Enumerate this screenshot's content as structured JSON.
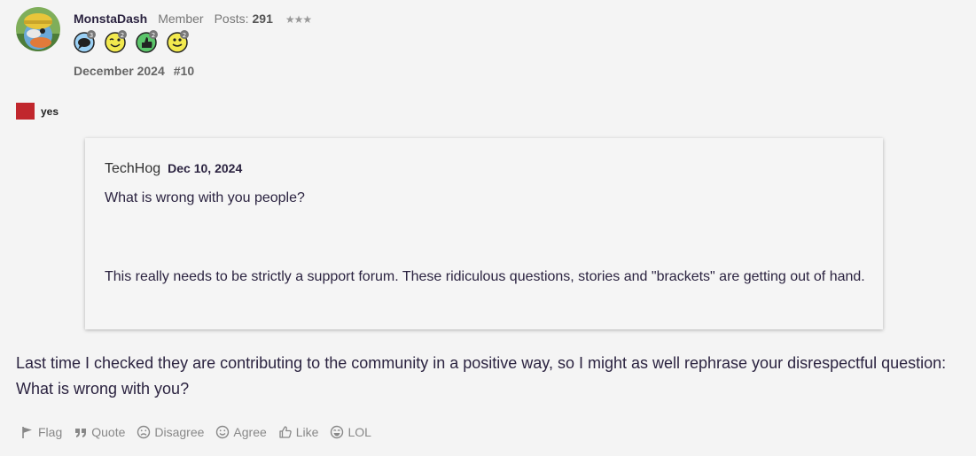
{
  "post": {
    "author": "MonstaDash",
    "role": "Member",
    "posts_label": "Posts:",
    "posts_count": "291",
    "stars": "★★★",
    "date": "December 2024",
    "number": "#10",
    "badges": [
      {
        "icon": "speech-bubble-icon",
        "count": "3",
        "color": "#9ad0f5"
      },
      {
        "icon": "wink-face-icon",
        "count": "2",
        "color": "#f2e94e"
      },
      {
        "icon": "thumbs-up-icon",
        "count": "2",
        "color": "#5bc56a"
      },
      {
        "icon": "smile-face-icon",
        "count": "2",
        "color": "#f2e94e"
      }
    ]
  },
  "flag": {
    "color": "#c1272d",
    "label": "yes"
  },
  "quote": {
    "author": "TechHog",
    "date": "Dec 10, 2024",
    "line1": "What is wrong with you people?",
    "line2": "This really needs to be strictly a support forum. These ridiculous questions, stories and \"brackets\" are getting out of hand."
  },
  "reply": "Last time I checked they are contributing to the community in a positive way, so I might as well rephrase your disrespectful question: What is wrong with you?",
  "actions": {
    "flag": "Flag",
    "quote": "Quote",
    "disagree": "Disagree",
    "agree": "Agree",
    "like": "Like",
    "lol": "LOL"
  }
}
